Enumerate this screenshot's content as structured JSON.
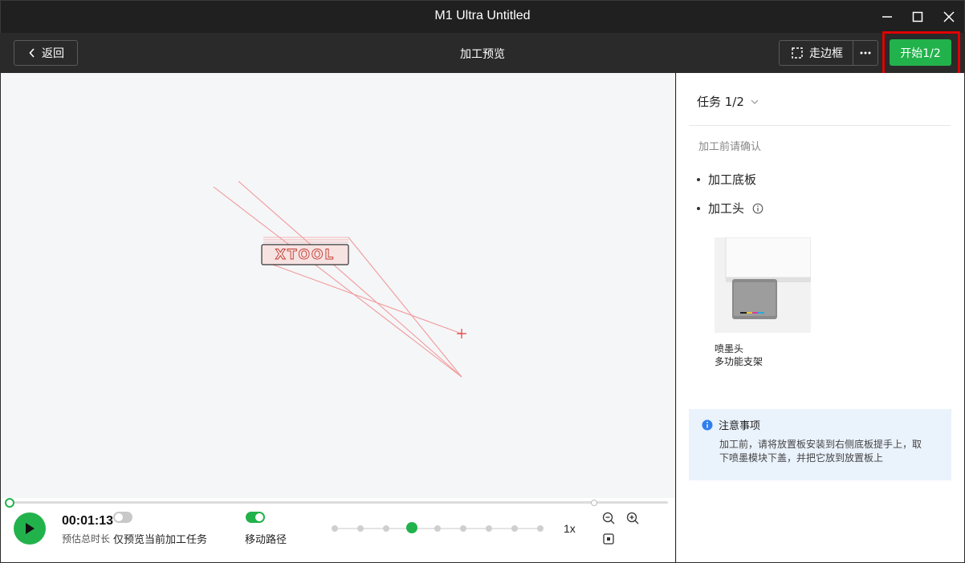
{
  "window": {
    "title": "M1 Ultra Untitled"
  },
  "toolbar": {
    "back_label": "返回",
    "page_title": "加工预览",
    "frame_label": "走边框",
    "start_label": "开始1/2"
  },
  "canvas": {
    "design_text": "XTOOL"
  },
  "playback": {
    "time": "00:01:13",
    "time_label": "预估总时长",
    "preview_only_label": "仅预览当前加工任务",
    "preview_only_on": false,
    "move_path_label": "移动路径",
    "move_path_on": true,
    "speed_label": "1x",
    "speed_index": 3,
    "speed_steps": 9
  },
  "panel": {
    "task_title": "任务 1/2",
    "confirm_label": "加工前请确认",
    "items": [
      {
        "label": "加工底板"
      },
      {
        "label": "加工头"
      }
    ],
    "head_name": "喷墨头",
    "head_mount": "多功能支架",
    "notice_title": "注意事项",
    "notice_body": "加工前，请将放置板安装到右侧底板提手上，取下喷墨模块下盖，并把它放到放置板上"
  },
  "colors": {
    "accent": "#22b24c",
    "highlight": "#e00000",
    "path": "#f19a9a"
  }
}
